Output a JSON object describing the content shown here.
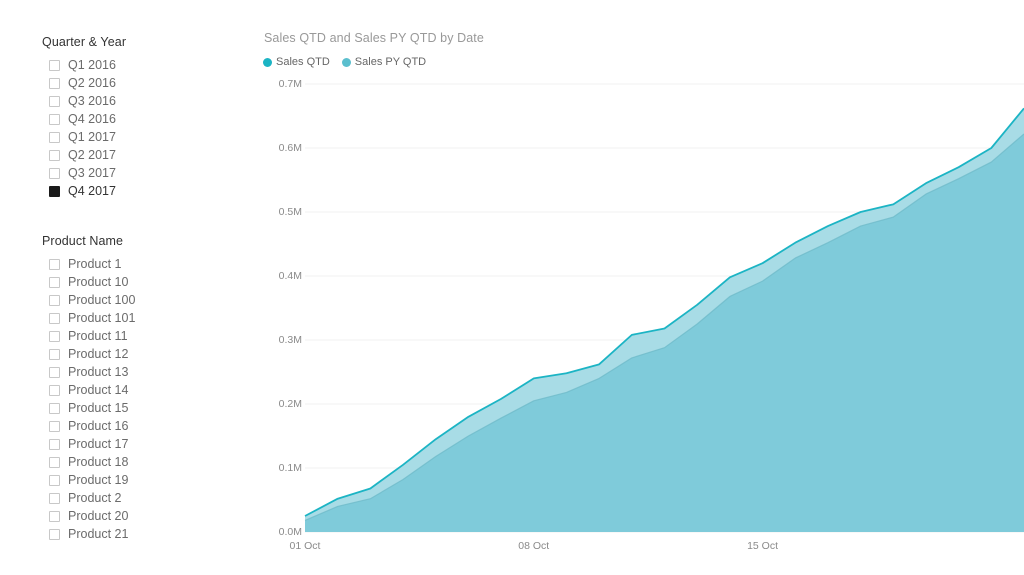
{
  "slicers": [
    {
      "name": "quarter-year",
      "title": "Quarter & Year",
      "items": [
        {
          "label": "Q1 2016",
          "checked": false
        },
        {
          "label": "Q2 2016",
          "checked": false
        },
        {
          "label": "Q3 2016",
          "checked": false
        },
        {
          "label": "Q4 2016",
          "checked": false
        },
        {
          "label": "Q1 2017",
          "checked": false
        },
        {
          "label": "Q2 2017",
          "checked": false
        },
        {
          "label": "Q3 2017",
          "checked": false
        },
        {
          "label": "Q4 2017",
          "checked": true
        }
      ]
    },
    {
      "name": "product-name",
      "title": "Product Name",
      "items": [
        {
          "label": "Product 1",
          "checked": false
        },
        {
          "label": "Product 10",
          "checked": false
        },
        {
          "label": "Product 100",
          "checked": false
        },
        {
          "label": "Product 101",
          "checked": false
        },
        {
          "label": "Product 11",
          "checked": false
        },
        {
          "label": "Product 12",
          "checked": false
        },
        {
          "label": "Product 13",
          "checked": false
        },
        {
          "label": "Product 14",
          "checked": false
        },
        {
          "label": "Product 15",
          "checked": false
        },
        {
          "label": "Product 16",
          "checked": false
        },
        {
          "label": "Product 17",
          "checked": false
        },
        {
          "label": "Product 18",
          "checked": false
        },
        {
          "label": "Product 19",
          "checked": false
        },
        {
          "label": "Product 2",
          "checked": false
        },
        {
          "label": "Product 20",
          "checked": false
        },
        {
          "label": "Product 21",
          "checked": false
        }
      ]
    }
  ],
  "colors": {
    "series_primary": "#1CB4C4",
    "series_primary_fill": "#A8DCE6",
    "series_secondary": "#5BBFCE",
    "series_secondary_fill": "#7FCBDA",
    "gridline": "#f2f2f2",
    "axis_text": "#8a8a8a",
    "title_text": "#999999",
    "checkbox_checked": "#1a1a1a"
  },
  "chart_data": {
    "type": "area",
    "title": "Sales QTD and Sales PY QTD by Date",
    "xlabel": "",
    "ylabel": "",
    "ylim": [
      0,
      700000
    ],
    "ytick_labels": [
      "0.0M",
      "0.1M",
      "0.2M",
      "0.3M",
      "0.4M",
      "0.5M",
      "0.6M",
      "0.7M"
    ],
    "ytick_values": [
      0,
      100000,
      200000,
      300000,
      400000,
      500000,
      600000,
      700000
    ],
    "xtick_labels": [
      "01 Oct",
      "08 Oct",
      "15 Oct"
    ],
    "xtick_indices": [
      0,
      7,
      14
    ],
    "grid": true,
    "legend_position": "top-left",
    "x": [
      "01 Oct",
      "02 Oct",
      "03 Oct",
      "04 Oct",
      "05 Oct",
      "06 Oct",
      "07 Oct",
      "08 Oct",
      "09 Oct",
      "10 Oct",
      "11 Oct",
      "12 Oct",
      "13 Oct",
      "14 Oct",
      "15 Oct",
      "16 Oct",
      "17 Oct",
      "18 Oct",
      "19 Oct",
      "20 Oct"
    ],
    "series": [
      {
        "name": "Sales QTD",
        "color": "#1CB4C4",
        "values": [
          25000,
          52000,
          68000,
          105000,
          145000,
          180000,
          208000,
          240000,
          248000,
          262000,
          308000,
          318000,
          355000,
          398000,
          420000,
          452000,
          478000,
          500000,
          512000,
          545000,
          570000,
          600000,
          662000
        ]
      },
      {
        "name": "Sales PY QTD",
        "color": "#5BBFCE",
        "values": [
          18000,
          40000,
          52000,
          82000,
          118000,
          150000,
          178000,
          205000,
          218000,
          240000,
          272000,
          288000,
          325000,
          368000,
          392000,
          428000,
          452000,
          478000,
          492000,
          528000,
          552000,
          578000,
          622000
        ]
      }
    ]
  }
}
